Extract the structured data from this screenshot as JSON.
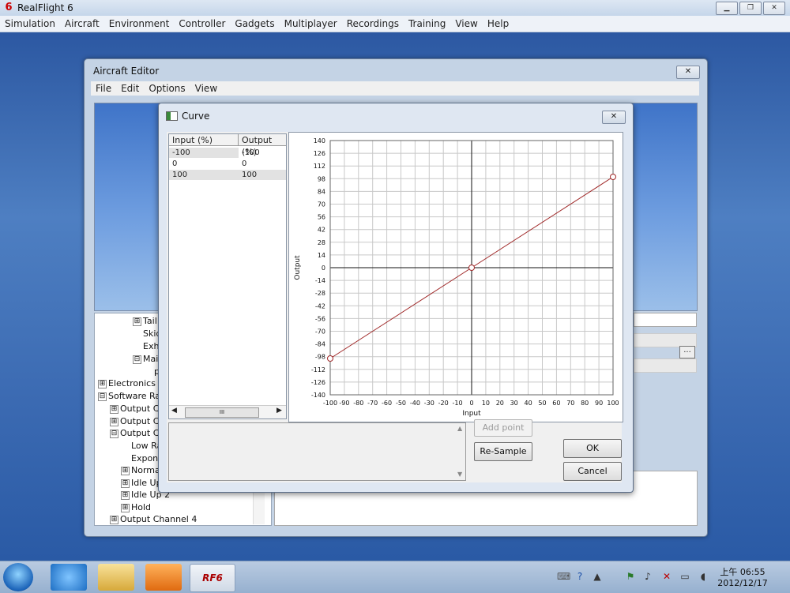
{
  "app": {
    "title": "RealFlight 6",
    "logo_glyph": "6",
    "window_buttons": {
      "minimize": "▁",
      "restore": "❐",
      "close": "✕"
    },
    "menu": [
      "Simulation",
      "Aircraft",
      "Environment",
      "Controller",
      "Gadgets",
      "Multiplayer",
      "Recordings",
      "Training",
      "View",
      "Help"
    ]
  },
  "editor": {
    "title": "Aircraft Editor",
    "close_glyph": "✕",
    "menu": [
      "File",
      "Edit",
      "Options",
      "View"
    ],
    "tree": [
      {
        "expander": "⊞",
        "label": "Tail I"
      },
      {
        "expander": "",
        "label": "Skids"
      },
      {
        "expander": "",
        "label": "Exha"
      },
      {
        "expander": "⊟",
        "label": "Main"
      },
      {
        "expander": "",
        "label": "p"
      },
      {
        "expander": "⊞",
        "label": "Electronics"
      },
      {
        "expander": "⊟",
        "label": "Software Rad"
      },
      {
        "expander": "⊞",
        "label": "Output Ch"
      },
      {
        "expander": "⊞",
        "label": "Output Ch"
      },
      {
        "expander": "⊟",
        "label": "Output Ch"
      },
      {
        "expander": "",
        "label": "Low Ra"
      },
      {
        "expander": "",
        "label": "Expone"
      },
      {
        "expander": "⊞",
        "label": "Normal"
      },
      {
        "expander": "⊞",
        "label": "Idle Up"
      },
      {
        "expander": "⊞",
        "label": "Idle Up 2"
      },
      {
        "expander": "⊞",
        "label": "Hold"
      },
      {
        "expander": "⊞",
        "label": "Output Channel 4"
      }
    ],
    "ellipsis_label": "..."
  },
  "curve_dialog": {
    "title": "Curve",
    "close_glyph": "✕",
    "table": {
      "headers": [
        "Input (%)",
        "Output (%)"
      ],
      "rows": [
        [
          "-100",
          "-100"
        ],
        [
          "0",
          "0"
        ],
        [
          "100",
          "100"
        ]
      ],
      "scroll_thumb": "III"
    },
    "buttons": {
      "add_point": "Add point",
      "resample": "Re-Sample",
      "ok": "OK",
      "cancel": "Cancel"
    }
  },
  "chart_data": {
    "type": "line",
    "xlabel": "Input",
    "ylabel": "Output",
    "xlim": [
      -100,
      100
    ],
    "ylim": [
      -140,
      140
    ],
    "x_ticks": [
      -100,
      -90,
      -80,
      -70,
      -60,
      -50,
      -40,
      -30,
      -20,
      -10,
      0,
      10,
      20,
      30,
      40,
      50,
      60,
      70,
      80,
      90,
      100
    ],
    "y_ticks": [
      140,
      126,
      112,
      98,
      84,
      70,
      56,
      42,
      28,
      14,
      0,
      -14,
      -28,
      -42,
      -56,
      -70,
      -84,
      -98,
      -112,
      -126,
      -140
    ],
    "grid": true,
    "series": [
      {
        "x": [
          -100,
          0,
          100
        ],
        "y": [
          -100,
          0,
          100
        ],
        "color": "#a02828"
      }
    ]
  },
  "taskbar": {
    "clock_time": "上午 06:55",
    "clock_date": "2012/12/17",
    "app_button": "RF6"
  }
}
